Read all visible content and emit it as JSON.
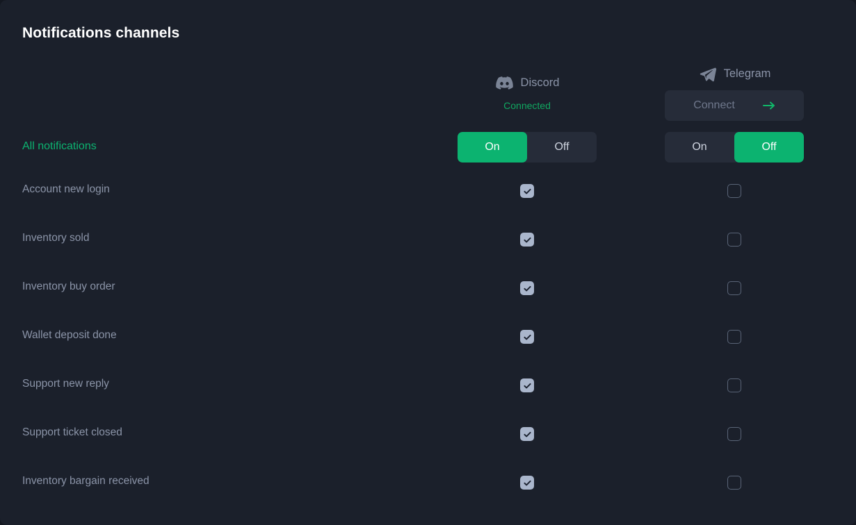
{
  "page": {
    "title": "Notifications channels",
    "accent_green": "#0cb370",
    "background": "#1b202b",
    "label_color": "#8b94a8"
  },
  "channels": [
    {
      "key": "discord",
      "name": "Discord",
      "icon": "discord-icon",
      "status": "Connected",
      "connect_label": null,
      "master": {
        "on_label": "On",
        "off_label": "Off",
        "selected": "On"
      }
    },
    {
      "key": "telegram",
      "name": "Telegram",
      "icon": "telegram-icon",
      "status": null,
      "connect_label": "Connect",
      "master": {
        "on_label": "On",
        "off_label": "Off",
        "selected": "Off"
      }
    }
  ],
  "master_row": {
    "label": "All notifications"
  },
  "rows": [
    {
      "label": "Account new login",
      "discord": true,
      "telegram": false
    },
    {
      "label": "Inventory sold",
      "discord": true,
      "telegram": false
    },
    {
      "label": "Inventory buy order",
      "discord": true,
      "telegram": false
    },
    {
      "label": "Wallet deposit done",
      "discord": true,
      "telegram": false
    },
    {
      "label": "Support new reply",
      "discord": true,
      "telegram": false
    },
    {
      "label": "Support ticket closed",
      "discord": true,
      "telegram": false
    },
    {
      "label": "Inventory bargain received",
      "discord": true,
      "telegram": false
    }
  ]
}
